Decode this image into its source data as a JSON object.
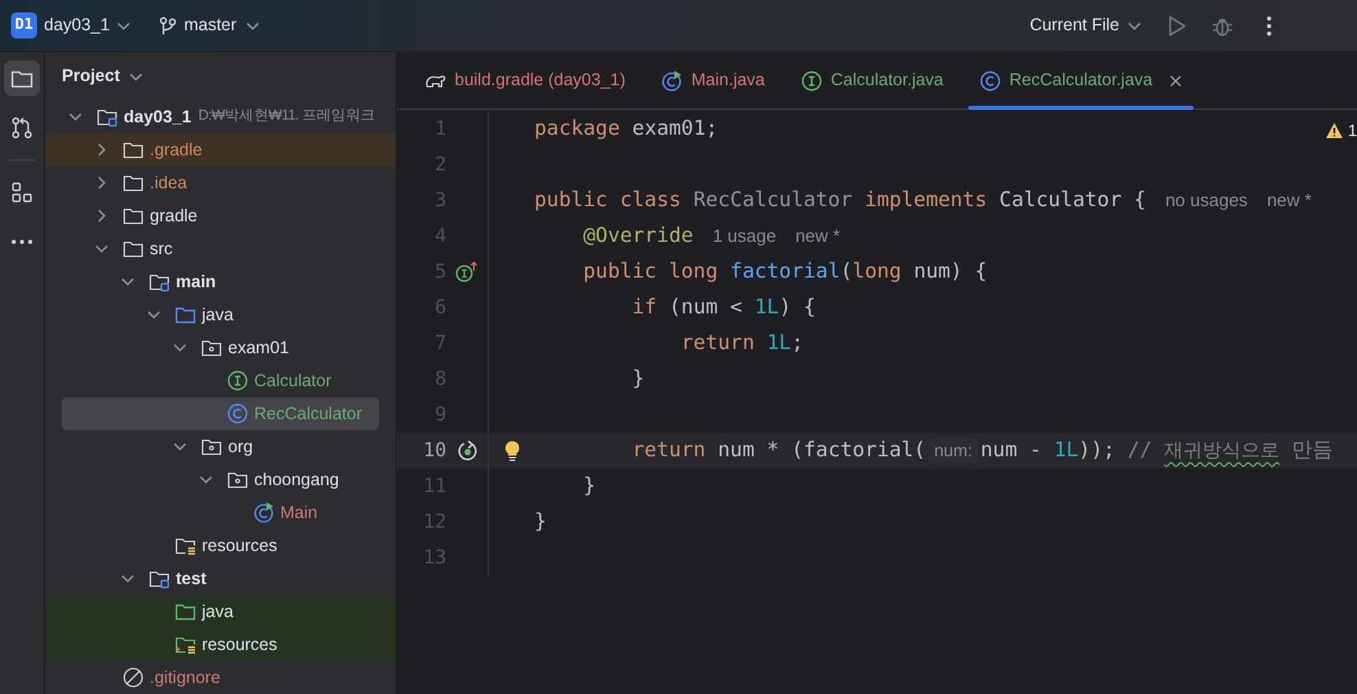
{
  "top_bar": {
    "project_badge": "D1",
    "project_name": "day03_1",
    "branch": "master",
    "run_config": "Current File"
  },
  "tool_strip": [
    {
      "selected": true
    },
    {
      "selected": false
    },
    {
      "selected": false
    },
    {
      "selected": false
    }
  ],
  "project_panel": {
    "title": "Project",
    "tree": [
      {
        "label": "day03_1",
        "path": "D:₩박세현₩11. 프레임워크",
        "kind": "module",
        "expanded": true,
        "selected": false,
        "children": [
          {
            "label": ".gradle",
            "kind": "excluded",
            "expanded": false,
            "color": "#d1875c",
            "selected": false
          },
          {
            "label": ".idea",
            "kind": "folder",
            "expanded": false,
            "color": "#d1875c",
            "selected": false
          },
          {
            "label": "gradle",
            "kind": "folder",
            "expanded": false,
            "selected": false
          },
          {
            "label": "src",
            "kind": "folder",
            "expanded": true,
            "selected": false,
            "children": [
              {
                "label": "main",
                "kind": "module",
                "expanded": true,
                "selected": false,
                "children": [
                  {
                    "label": "java",
                    "kind": "source",
                    "expanded": true,
                    "selected": false,
                    "children": [
                      {
                        "label": "exam01",
                        "kind": "package",
                        "expanded": true,
                        "selected": false,
                        "children": [
                          {
                            "label": "Calculator",
                            "kind": "interface",
                            "color": "#6aab73",
                            "selected": false
                          },
                          {
                            "label": "RecCalculator",
                            "kind": "class",
                            "color": "#6aab73",
                            "selected": true
                          }
                        ]
                      },
                      {
                        "label": "org",
                        "kind": "package",
                        "expanded": true,
                        "selected": false,
                        "children": [
                          {
                            "label": "choongang",
                            "kind": "package",
                            "expanded": true,
                            "selected": false,
                            "children": [
                              {
                                "label": "Main",
                                "kind": "main-class",
                                "color": "#d4766f",
                                "selected": false
                              }
                            ]
                          }
                        ]
                      }
                    ]
                  },
                  {
                    "label": "resources",
                    "kind": "resources",
                    "selected": false
                  }
                ]
              },
              {
                "label": "test",
                "kind": "module",
                "expanded": true,
                "selected": false,
                "children": [
                  {
                    "label": "java",
                    "kind": "test-source",
                    "selected": false
                  },
                  {
                    "label": "resources",
                    "kind": "test-resources",
                    "selected": false
                  }
                ]
              }
            ]
          },
          {
            "label": ".gitignore",
            "kind": "ignore-file",
            "color": "#d4766f",
            "selected": false
          }
        ]
      }
    ]
  },
  "tabs": [
    {
      "label": "build.gradle (day03_1)",
      "kind": "gradle",
      "color": "#d4766f",
      "selected": false
    },
    {
      "label": "Main.java",
      "kind": "main-class",
      "color": "#d4766f",
      "selected": false
    },
    {
      "label": "Calculator.java",
      "kind": "interface",
      "color": "#6aab73",
      "selected": false
    },
    {
      "label": "RecCalculator.java",
      "kind": "class",
      "color": "#6aab73",
      "selected": true
    }
  ],
  "editor": {
    "warning_count": "1",
    "lines": [
      {
        "number": "1",
        "current": false,
        "intention": false,
        "tokens": [
          {
            "kind": "keyword",
            "text": "package "
          },
          {
            "kind": "plain",
            "text": "exam01;"
          }
        ]
      },
      {
        "number": "2",
        "current": false,
        "intention": false
      },
      {
        "number": "3",
        "current": false,
        "intention": false,
        "tokens": [
          {
            "kind": "keyword",
            "text": "public class "
          },
          {
            "kind": "unused",
            "text": "RecCalculator "
          },
          {
            "kind": "keyword",
            "text": "implements "
          },
          {
            "kind": "plain",
            "text": "Calculator {"
          },
          {
            "kind": "hint",
            "text": "no usages"
          },
          {
            "kind": "hint",
            "text": "new *"
          }
        ]
      },
      {
        "number": "4",
        "current": false,
        "intention": false,
        "tokens": [
          {
            "kind": "annotation",
            "text": "    @Override"
          },
          {
            "kind": "hint",
            "text": "1 usage"
          },
          {
            "kind": "hint",
            "text": "new *"
          }
        ]
      },
      {
        "number": "5",
        "kind": "implementing-method",
        "current": false,
        "intention": false,
        "tokens": [
          {
            "kind": "keyword",
            "text": "    public long "
          },
          {
            "kind": "function",
            "text": "factorial"
          },
          {
            "kind": "plain",
            "text": "("
          },
          {
            "kind": "keyword",
            "text": "long "
          },
          {
            "kind": "plain",
            "text": "num) {"
          }
        ]
      },
      {
        "number": "6",
        "current": false,
        "intention": false,
        "tokens": [
          {
            "kind": "keyword",
            "text": "        if "
          },
          {
            "kind": "plain",
            "text": "(num < "
          },
          {
            "kind": "number",
            "text": "1L"
          },
          {
            "kind": "plain",
            "text": ") {"
          }
        ]
      },
      {
        "number": "7",
        "current": false,
        "intention": false,
        "tokens": [
          {
            "kind": "keyword",
            "text": "            return "
          },
          {
            "kind": "number",
            "text": "1L"
          },
          {
            "kind": "plain",
            "text": ";"
          }
        ]
      },
      {
        "number": "8",
        "current": false,
        "intention": false,
        "tokens": [
          {
            "kind": "plain",
            "text": "        }"
          }
        ]
      },
      {
        "number": "9",
        "current": false,
        "intention": false
      },
      {
        "number": "10",
        "kind": "recursive-call",
        "current": true,
        "intention": true,
        "tokens": [
          {
            "kind": "keyword",
            "text": "        return "
          },
          {
            "kind": "plain",
            "text": "num * (factorial("
          },
          {
            "kind": "inlay",
            "text": "num:"
          },
          {
            "kind": "plain",
            "text": "num - "
          },
          {
            "kind": "number",
            "text": "1L"
          },
          {
            "kind": "plain",
            "text": ")); "
          },
          {
            "kind": "comment",
            "text": "// "
          },
          {
            "kind": "typo",
            "text": "재귀방식으로"
          },
          {
            "kind": "comment",
            "text": " 만듬"
          }
        ]
      },
      {
        "number": "11",
        "current": false,
        "intention": false,
        "tokens": [
          {
            "kind": "plain",
            "text": "    }"
          }
        ]
      },
      {
        "number": "12",
        "current": false,
        "intention": false,
        "tokens": [
          {
            "kind": "plain",
            "text": "}"
          }
        ]
      },
      {
        "number": "13",
        "current": false,
        "intention": false
      }
    ]
  }
}
